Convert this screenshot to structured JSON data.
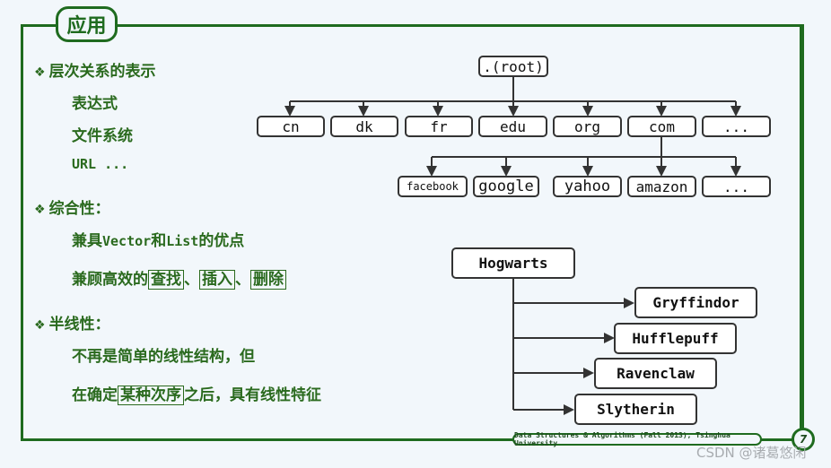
{
  "title": "应用",
  "left": {
    "sections": [
      {
        "heading": "层次关系的表示",
        "items": [
          "表达式",
          "文件系统",
          "URL ..."
        ]
      },
      {
        "heading": "综合性：",
        "items": [
          {
            "parts": [
              "兼具",
              "Vector",
              "和",
              "List",
              "的优点"
            ]
          },
          {
            "prefix": "兼顾高效的",
            "boxed": [
              "查找",
              "插入",
              "删除"
            ],
            "sep": "、"
          }
        ]
      },
      {
        "heading": "半线性：",
        "items": [
          "不再是简单的线性结构，但",
          {
            "prefix": "在确定",
            "boxed": "某种次序",
            "suffix": "之后，具有线性特征"
          }
        ]
      }
    ],
    "bullet_icon": "❖"
  },
  "dns_tree": {
    "root": ".(root)",
    "level1": [
      "cn",
      "dk",
      "fr",
      "edu",
      "org",
      "com",
      "..."
    ],
    "level2_parent": "com",
    "level2": [
      "facebook",
      "google",
      "yahoo",
      "amazon",
      "..."
    ]
  },
  "hogwarts_tree": {
    "root": "Hogwarts",
    "children": [
      "Gryffindor",
      "Hufflepuff",
      "Ravenclaw",
      "Slytherin"
    ]
  },
  "footer": {
    "text": "Data Structures & Algorithms (Fall 2013), Tsinghua University",
    "page": "7"
  },
  "watermark": "CSDN @诸葛悠闲",
  "colors": {
    "accent": "#1f6b1f",
    "text": "#2a6a1e",
    "node_border": "#333333"
  }
}
